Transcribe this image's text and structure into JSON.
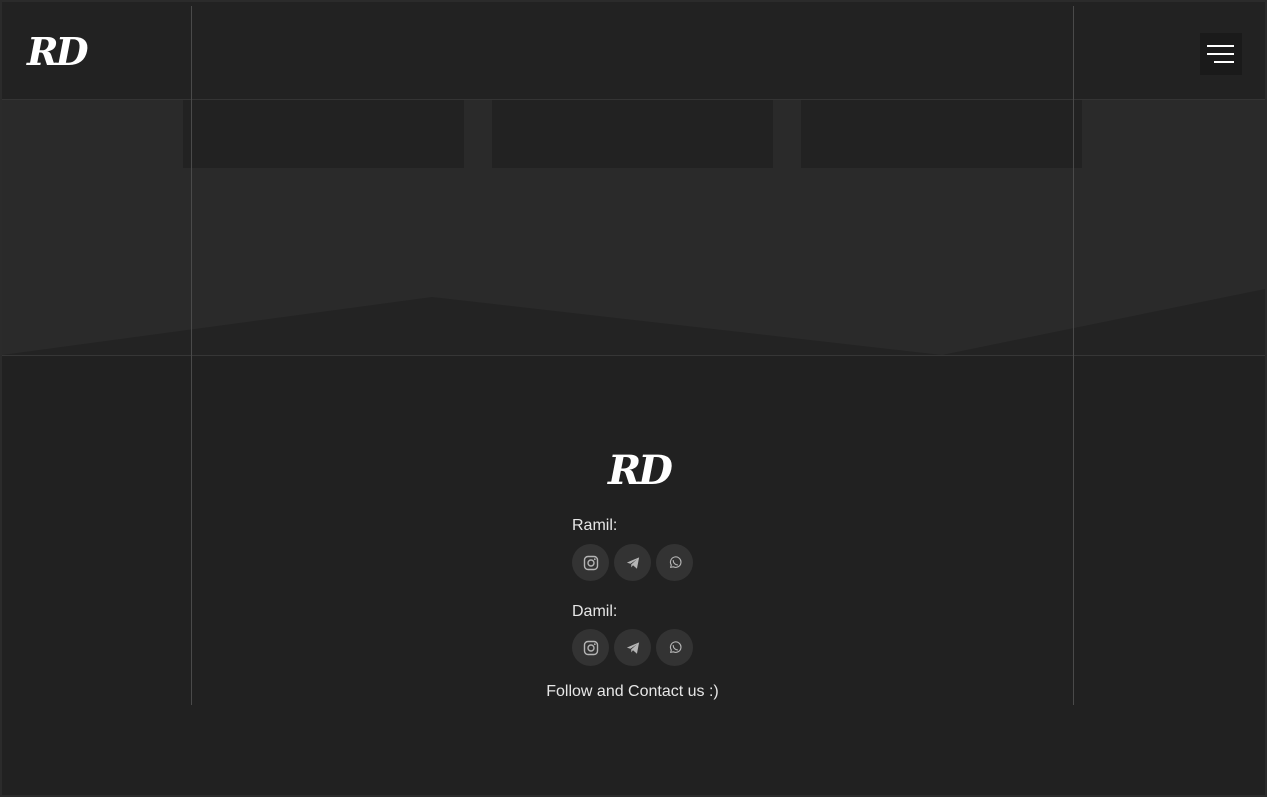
{
  "brand": {
    "logo_text": "RD"
  },
  "header": {
    "menu_icon": "hamburger-menu-icon"
  },
  "hero": {
    "cards": [
      {
        "id": 1
      },
      {
        "id": 2
      },
      {
        "id": 3
      }
    ]
  },
  "footer": {
    "logo_text": "RD",
    "contacts": [
      {
        "name": "Ramil:",
        "links": [
          {
            "icon": "instagram-icon"
          },
          {
            "icon": "telegram-icon"
          },
          {
            "icon": "whatsapp-icon"
          }
        ]
      },
      {
        "name": "Damil:",
        "links": [
          {
            "icon": "instagram-icon"
          },
          {
            "icon": "telegram-icon"
          },
          {
            "icon": "whatsapp-icon"
          }
        ]
      }
    ],
    "tagline": "Follow and Contact us :)"
  },
  "colors": {
    "background": "#212121",
    "hero": "#2a2a2a",
    "social_button": "#333333",
    "text": "#e6e6e6",
    "icon": "#b5b5b5"
  }
}
